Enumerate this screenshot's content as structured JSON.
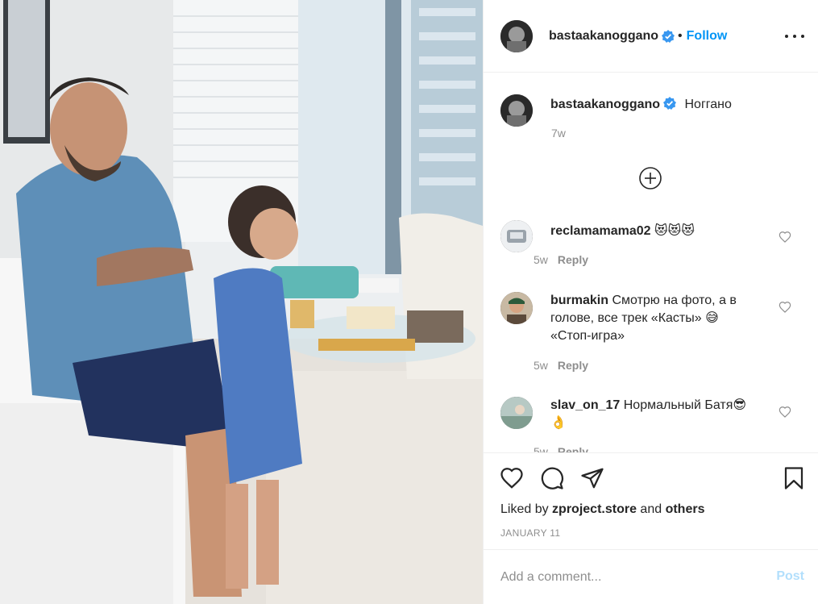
{
  "post": {
    "author": "bastaakanoggano",
    "follow_label": "Follow",
    "separator": "•",
    "caption_text": "Ноггано",
    "caption_time": "7w",
    "liked_prefix": "Liked by",
    "liked_user": "zproject.store",
    "liked_and": "and",
    "liked_others": "others",
    "date": "JANUARY 11"
  },
  "comments": [
    {
      "user": "reclamamama02",
      "text": "😻😻😻",
      "time": "5w",
      "reply_label": "Reply"
    },
    {
      "user": "burmakin",
      "text": "Смотрю на фото, а в голове, все трек «Касты» 😅 «Стоп-игра»",
      "time": "5w",
      "reply_label": "Reply"
    },
    {
      "user": "slav_on_17",
      "text": "Нормальный Батя😎👌",
      "time": "5w",
      "reply_label": "Reply"
    }
  ],
  "add_comment": {
    "placeholder": "Add a comment...",
    "post_label": "Post"
  },
  "colors": {
    "accent": "#0095f6",
    "verified": "#3897f0",
    "post_disabled": "#b2dffc",
    "muted": "#8e8e8e"
  },
  "icons": {
    "like": "heart-icon",
    "comment": "speech-bubble-icon",
    "share": "paper-plane-icon",
    "save": "bookmark-icon",
    "more": "ellipsis-icon",
    "load_more": "plus-circle-icon",
    "verified": "verified-badge-icon"
  }
}
